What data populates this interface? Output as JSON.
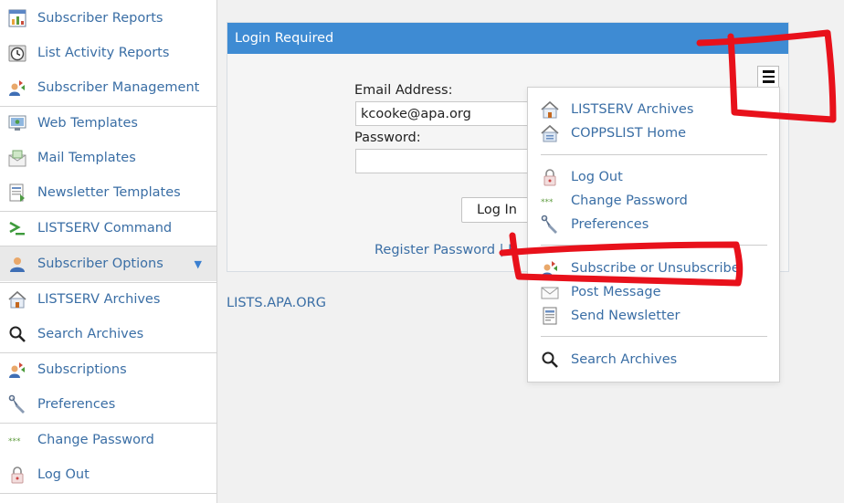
{
  "sidebar": {
    "items": [
      {
        "label": "Subscriber Reports",
        "icon": "report-chart-icon"
      },
      {
        "label": "List Activity Reports",
        "icon": "clock-icon"
      },
      {
        "label": "Subscriber Management",
        "icon": "users-icon"
      },
      {
        "label": "Web Templates",
        "icon": "web-template-icon"
      },
      {
        "label": "Mail Templates",
        "icon": "mail-template-icon"
      },
      {
        "label": "Newsletter Templates",
        "icon": "newsletter-template-icon"
      },
      {
        "label": "LISTSERV Command",
        "icon": "command-prompt-icon"
      },
      {
        "label": "Subscriber Options",
        "icon": "user-icon",
        "active": true,
        "caret": "▼"
      },
      {
        "label": "LISTSERV Archives",
        "icon": "archive-home-icon"
      },
      {
        "label": "Search Archives",
        "icon": "magnifier-icon"
      },
      {
        "label": "Subscriptions",
        "icon": "users-icon"
      },
      {
        "label": "Preferences",
        "icon": "wrench-icon"
      },
      {
        "label": "Change Password",
        "icon": "password-stars-icon"
      },
      {
        "label": "Log Out",
        "icon": "padlock-icon"
      }
    ]
  },
  "login": {
    "title": "Login Required",
    "email_label": "Email Address:",
    "email_value": "kcooke@apa.org",
    "password_label": "Password:",
    "password_value": "",
    "submit_label": "Log In",
    "register_link": "Register Password",
    "separator": "|",
    "forgot_link_partial": "F"
  },
  "footer": {
    "host_link": "LISTS.APA.ORG"
  },
  "menu": {
    "groups": [
      [
        {
          "label": "LISTSERV Archives",
          "icon": "archive-home-icon"
        },
        {
          "label": "COPPSLIST Home",
          "icon": "list-home-icon"
        }
      ],
      [
        {
          "label": "Log Out",
          "icon": "padlock-icon"
        },
        {
          "label": "Change Password",
          "icon": "password-stars-icon"
        },
        {
          "label": "Preferences",
          "icon": "wrench-icon"
        }
      ],
      [
        {
          "label": "Subscribe or Unsubscribe",
          "icon": "users-icon"
        },
        {
          "label": "Post Message",
          "icon": "envelope-icon"
        },
        {
          "label": "Send Newsletter",
          "icon": "newsletter-icon"
        }
      ],
      [
        {
          "label": "Search Archives",
          "icon": "magnifier-icon"
        }
      ]
    ]
  },
  "colors": {
    "header_blue": "#3e8bd3",
    "link_blue": "#3a6ea5",
    "annotation_red": "#e8111b"
  }
}
